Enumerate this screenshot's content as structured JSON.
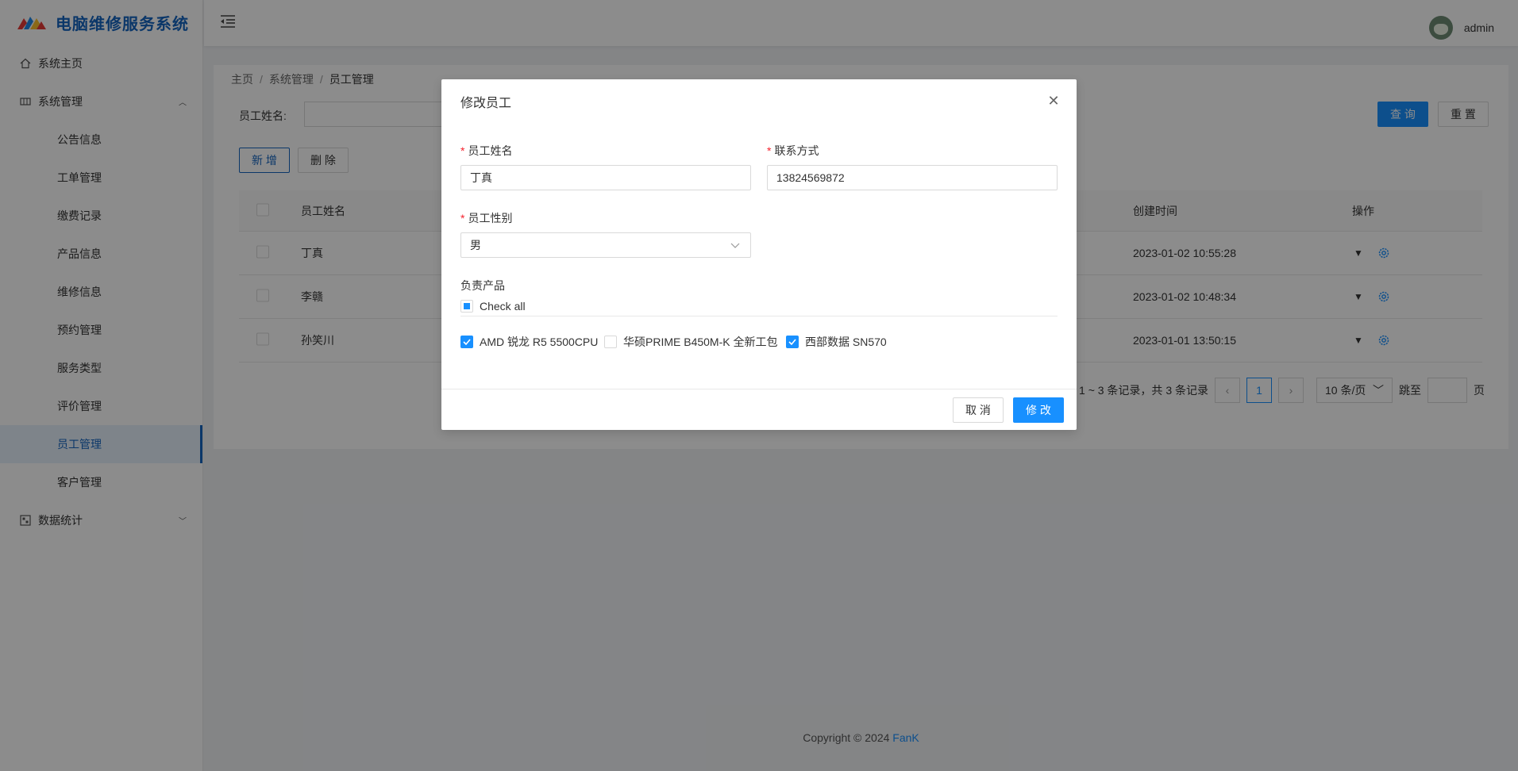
{
  "app": {
    "title": "电脑维修服务系统"
  },
  "sidebar": {
    "home": "系统主页",
    "system_group": "系统管理",
    "items": [
      "公告信息",
      "工单管理",
      "缴费记录",
      "产品信息",
      "维修信息",
      "预约管理",
      "服务类型",
      "评价管理",
      "员工管理",
      "客户管理"
    ],
    "active_item": "员工管理",
    "stats_group": "数据统计"
  },
  "header": {
    "username": "admin"
  },
  "breadcrumb": [
    "主页",
    "系统管理",
    "员工管理"
  ],
  "search": {
    "label": "员工姓名:",
    "query_button": "查 询",
    "reset_button": "重 置"
  },
  "toolbar": {
    "add_button": "新 增",
    "delete_button": "删 除"
  },
  "table": {
    "columns": {
      "name": "员工姓名",
      "created": "创建时间",
      "operation": "操作"
    },
    "rows": [
      {
        "name": "丁真",
        "created": "2023-01-02 10:55:28"
      },
      {
        "name": "李赣",
        "created": "2023-01-02 10:48:34"
      },
      {
        "name": "孙笑川",
        "created": "2023-01-01 13:50:15"
      }
    ]
  },
  "pagination": {
    "total_text": "1 ~ 3 条记录，共 3 条记录",
    "current_page": "1",
    "page_size": "10 条/页",
    "jump_label": "跳至",
    "page_suffix": "页"
  },
  "footer": {
    "copyright": "Copyright © 2024 ",
    "brand": "FanK"
  },
  "modal": {
    "title": "修改员工",
    "name_label": "员工姓名",
    "name_value": "丁真",
    "phone_label": "联系方式",
    "phone_value": "13824569872",
    "gender_label": "员工性别",
    "gender_value": "男",
    "products_label": "负责产品",
    "check_all_label": "Check all",
    "products": [
      {
        "label": "AMD 锐龙 R5 5500CPU",
        "checked": true
      },
      {
        "label": "华硕PRIME B450M-K 全新工包",
        "checked": false
      },
      {
        "label": "西部数据 SN570",
        "checked": true
      }
    ],
    "cancel_button": "取 消",
    "ok_button": "修 改"
  },
  "colors": {
    "primary": "#1890ff",
    "brand": "#1565c0",
    "required": "#f5222d"
  }
}
